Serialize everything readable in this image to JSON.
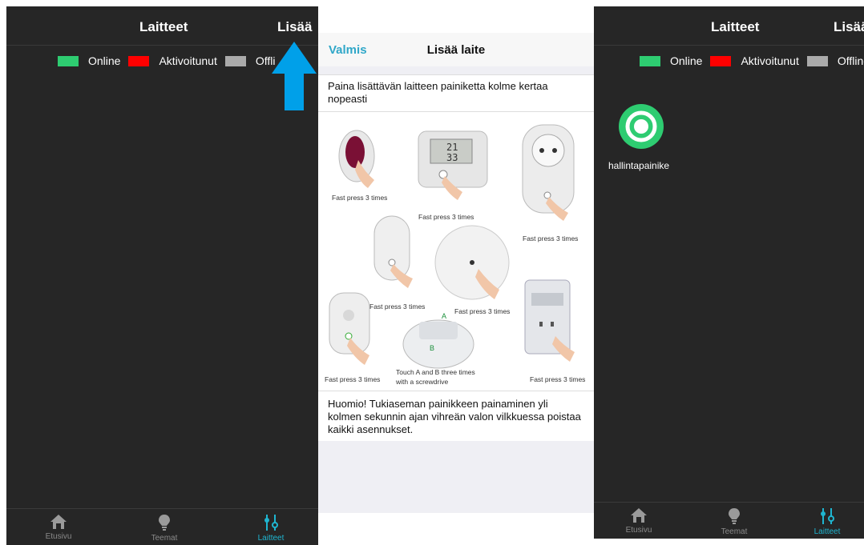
{
  "left_screen": {
    "title": "Laitteet",
    "add_label": "Lisää",
    "legend": [
      {
        "label": "Online",
        "color": "#2ecc71"
      },
      {
        "label": "Aktivoitunut",
        "color": "#ff0000"
      },
      {
        "label": "Offli",
        "color": "#aaaaaa"
      }
    ],
    "tabs": [
      {
        "label": "Etusivu",
        "icon": "home-icon"
      },
      {
        "label": "Teemat",
        "icon": "bulb-icon"
      },
      {
        "label": "Laitteet",
        "icon": "sliders-icon",
        "active": true
      }
    ],
    "arrow_color": "#00a0e9"
  },
  "add_device_screen": {
    "done_label": "Valmis",
    "title": "Lisää laite",
    "instruction": "Paina lisättävän laitteen painiketta kolme kertaa nopeasti",
    "captions": {
      "c1": "Fast press 3 times",
      "c2": "Fast press 3 times",
      "c3": "Fast press 3 times",
      "c4": "Fast press 3 times",
      "c5": "Fast press 3 times",
      "c6": "Fast press 3 times",
      "c7a": "Touch A and B three times",
      "c7b": "with a screwdrive",
      "c8": "Fast press 3 times",
      "lcd_top": "21",
      "lcd_bottom": "33",
      "mark_a": "A",
      "mark_b": "B"
    },
    "note": "Huomio! Tukiaseman painikkeen painaminen yli kolmen sekunnin ajan vihreän valon vilkkuessa poistaa kaikki asennukset."
  },
  "right_screen": {
    "title": "Laitteet",
    "add_label": "Lisää",
    "legend": [
      {
        "label": "Online",
        "color": "#2ecc71"
      },
      {
        "label": "Aktivoitunut",
        "color": "#ff0000"
      },
      {
        "label": "Offline",
        "color": "#aaaaaa"
      }
    ],
    "device": {
      "label": "hallintapainike",
      "icon": "button-device-icon",
      "status_color": "#2ecc71"
    },
    "tabs": [
      {
        "label": "Etusivu",
        "icon": "home-icon"
      },
      {
        "label": "Teemat",
        "icon": "bulb-icon"
      },
      {
        "label": "Laitteet",
        "icon": "sliders-icon",
        "active": true
      }
    ]
  }
}
